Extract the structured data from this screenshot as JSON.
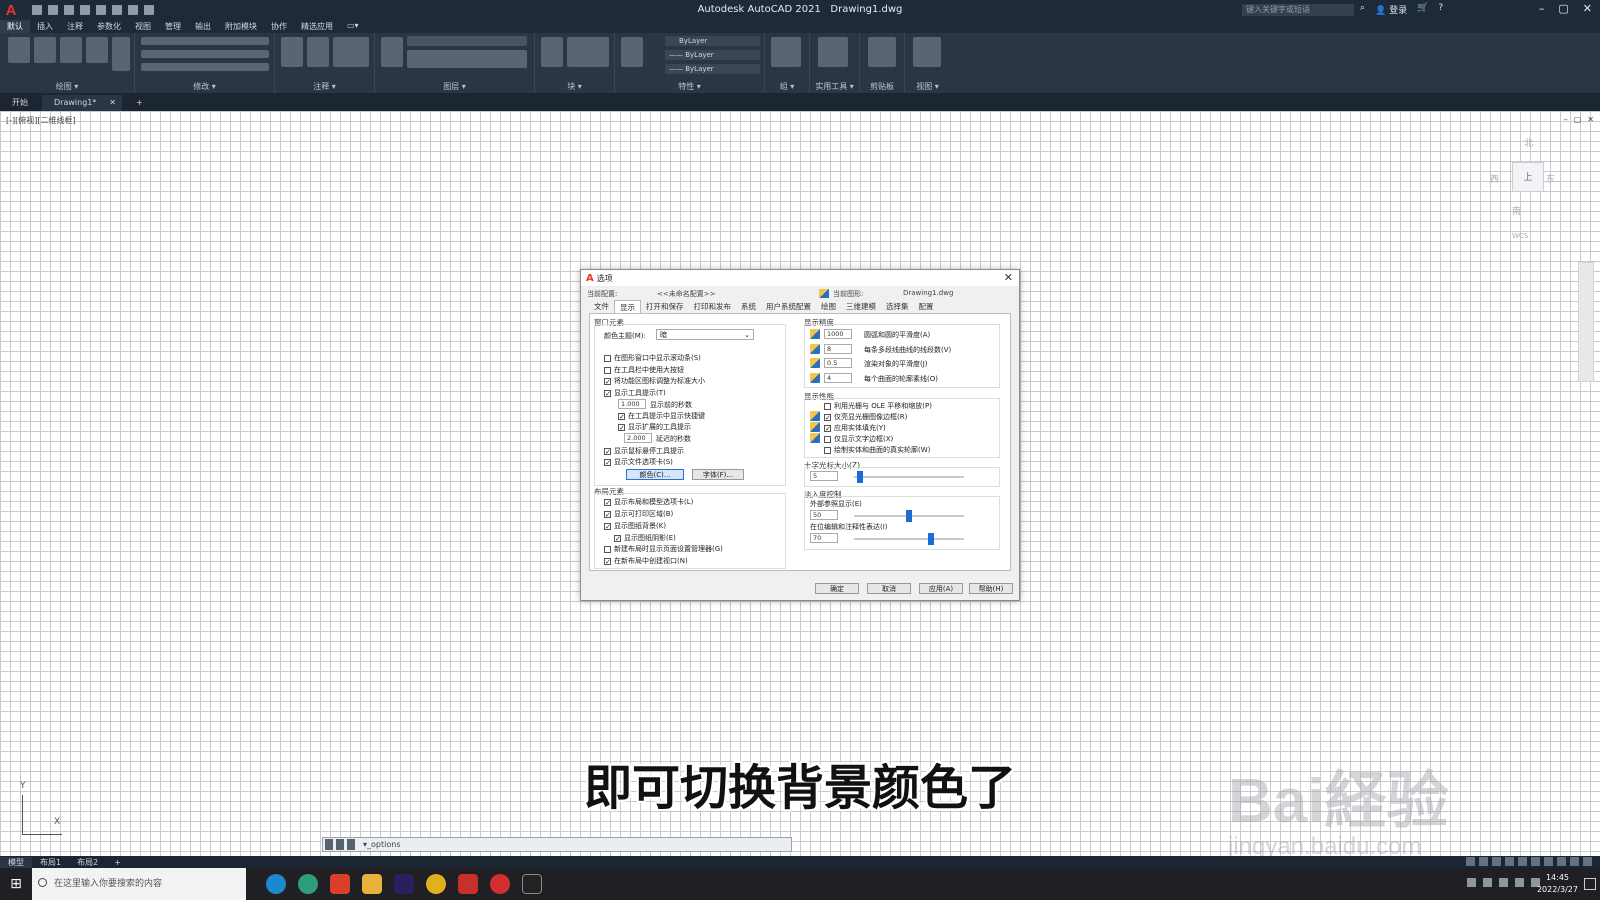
{
  "app": {
    "title": "Autodesk AutoCAD 2021",
    "document": "Drawing1.dwg",
    "search_placeholder": "键入关键字或短语",
    "login_label": "登录",
    "qat_icons": [
      "new-icon",
      "open-icon",
      "save-icon",
      "saveas-icon",
      "web-open-icon",
      "plot-icon",
      "undo-icon",
      "redo-icon"
    ]
  },
  "menu": [
    "默认",
    "插入",
    "注释",
    "参数化",
    "视图",
    "管理",
    "输出",
    "附加模块",
    "协作",
    "精选应用",
    "▭▾"
  ],
  "ribbon_panels": [
    "绘图 ▾",
    "修改 ▾",
    "注释 ▾",
    "图层 ▾",
    "块 ▾",
    "特性 ▾",
    "组 ▾",
    "实用工具 ▾",
    "剪贴板",
    "视图 ▾"
  ],
  "ribbon": {
    "bylayer1": "ByLayer",
    "bylayer2": "—— ByLayer",
    "bylayer3": "—— ByLayer"
  },
  "tabs": {
    "start": "开始",
    "doc": "Drawing1*",
    "add": "+"
  },
  "viewport": {
    "label": "[-][俯视][二维线框]",
    "compass": {
      "n": "北",
      "w": "西",
      "e": "东",
      "s": "南",
      "cube": "上",
      "wcs": "WCS"
    }
  },
  "cmdline": {
    "text": "▾_options"
  },
  "caption": "即可切换背景颜色了",
  "watermark": {
    "line1": "Bai経验",
    "line2": "jingyan.baidu.com"
  },
  "status": {
    "tabs": [
      "模型",
      "布局1",
      "布局2",
      "+"
    ],
    "active": "模型"
  },
  "taskbar": {
    "search": "在这里输入你要搜索的内容",
    "time": "14:45",
    "date": "2022/3/27",
    "apps": [
      "edge-icon",
      "edge-dev-icon",
      "wps-icon",
      "file-explorer-icon",
      "premiere-icon",
      "chrome-icon",
      "autocad-icon",
      "recorder-icon",
      "capcut-icon"
    ]
  },
  "dialog": {
    "title": "选项",
    "profile_label": "当前配置:",
    "profile_value": "<<未命名配置>>",
    "drawing_label": "当前图形:",
    "drawing_value": "Drawing1.dwg",
    "tabs": [
      "文件",
      "显示",
      "打开和保存",
      "打印和发布",
      "系统",
      "用户系统配置",
      "绘图",
      "三维建模",
      "选择集",
      "配置"
    ],
    "selected_tab": "显示",
    "window_elements": {
      "title": "窗口元素",
      "color_scheme_label": "颜色主题(M):",
      "color_scheme_value": "暗",
      "checks": [
        {
          "label": "在图形窗口中显示滚动条(S)",
          "checked": false
        },
        {
          "label": "在工具栏中使用大按钮",
          "checked": false
        },
        {
          "label": "将功能区图标调整为标准大小",
          "checked": true
        },
        {
          "label": "显示工具提示(T)",
          "checked": true
        }
      ],
      "tooltip_delay_value": "1.000",
      "tooltip_delay_label": "显示前的秒数",
      "sub_checks": [
        {
          "label": "在工具提示中显示快捷键",
          "checked": true
        },
        {
          "label": "显示扩展的工具提示",
          "checked": true
        }
      ],
      "ext_delay_value": "2.000",
      "ext_delay_label": "延迟的秒数",
      "checks2": [
        {
          "label": "显示鼠标悬停工具提示",
          "checked": true
        },
        {
          "label": "显示文件选项卡(S)",
          "checked": true
        }
      ],
      "colors_button": "颜色(C)...",
      "fonts_button": "字体(F)..."
    },
    "layout_elements": {
      "title": "布局元素",
      "checks": [
        {
          "label": "显示布局和模型选项卡(L)",
          "checked": true
        },
        {
          "label": "显示可打印区域(B)",
          "checked": true
        },
        {
          "label": "显示图纸背景(K)",
          "checked": true
        },
        {
          "label": "显示图纸阴影(E)",
          "checked": true
        },
        {
          "label": "新建布局时显示页面设置管理器(G)",
          "checked": false
        },
        {
          "label": "在新布局中创建视口(N)",
          "checked": true
        }
      ]
    },
    "display_resolution": {
      "title": "显示精度",
      "rows": [
        {
          "value": "1000",
          "label": "圆弧和圆的平滑度(A)"
        },
        {
          "value": "8",
          "label": "每条多段线曲线的线段数(V)"
        },
        {
          "value": "0.5",
          "label": "渲染对象的平滑度(J)"
        },
        {
          "value": "4",
          "label": "每个曲面的轮廓素线(O)"
        }
      ]
    },
    "display_performance": {
      "title": "显示性能",
      "checks": [
        {
          "label": "利用光栅与 OLE 平移和缩放(P)",
          "checked": false
        },
        {
          "label": "仅亮显光栅图像边框(R)",
          "checked": true
        },
        {
          "label": "应用实体填充(Y)",
          "checked": true
        },
        {
          "label": "仅显示文字边框(X)",
          "checked": false
        },
        {
          "label": "绘制实体和曲面的真实轮廓(W)",
          "checked": false
        }
      ]
    },
    "crosshair": {
      "title": "十字光标大小(Z)",
      "value": "5",
      "level": 0.05
    },
    "fade": {
      "title": "淡入度控制",
      "xref_label": "外部参照显示(E)",
      "xref_value": "50",
      "xref_level": 0.5,
      "inplace_label": "在位编辑和注释性表达(I)",
      "inplace_value": "70",
      "inplace_level": 0.7
    },
    "buttons": {
      "ok": "确定",
      "cancel": "取消",
      "apply": "应用(A)",
      "help": "帮助(H)"
    }
  }
}
